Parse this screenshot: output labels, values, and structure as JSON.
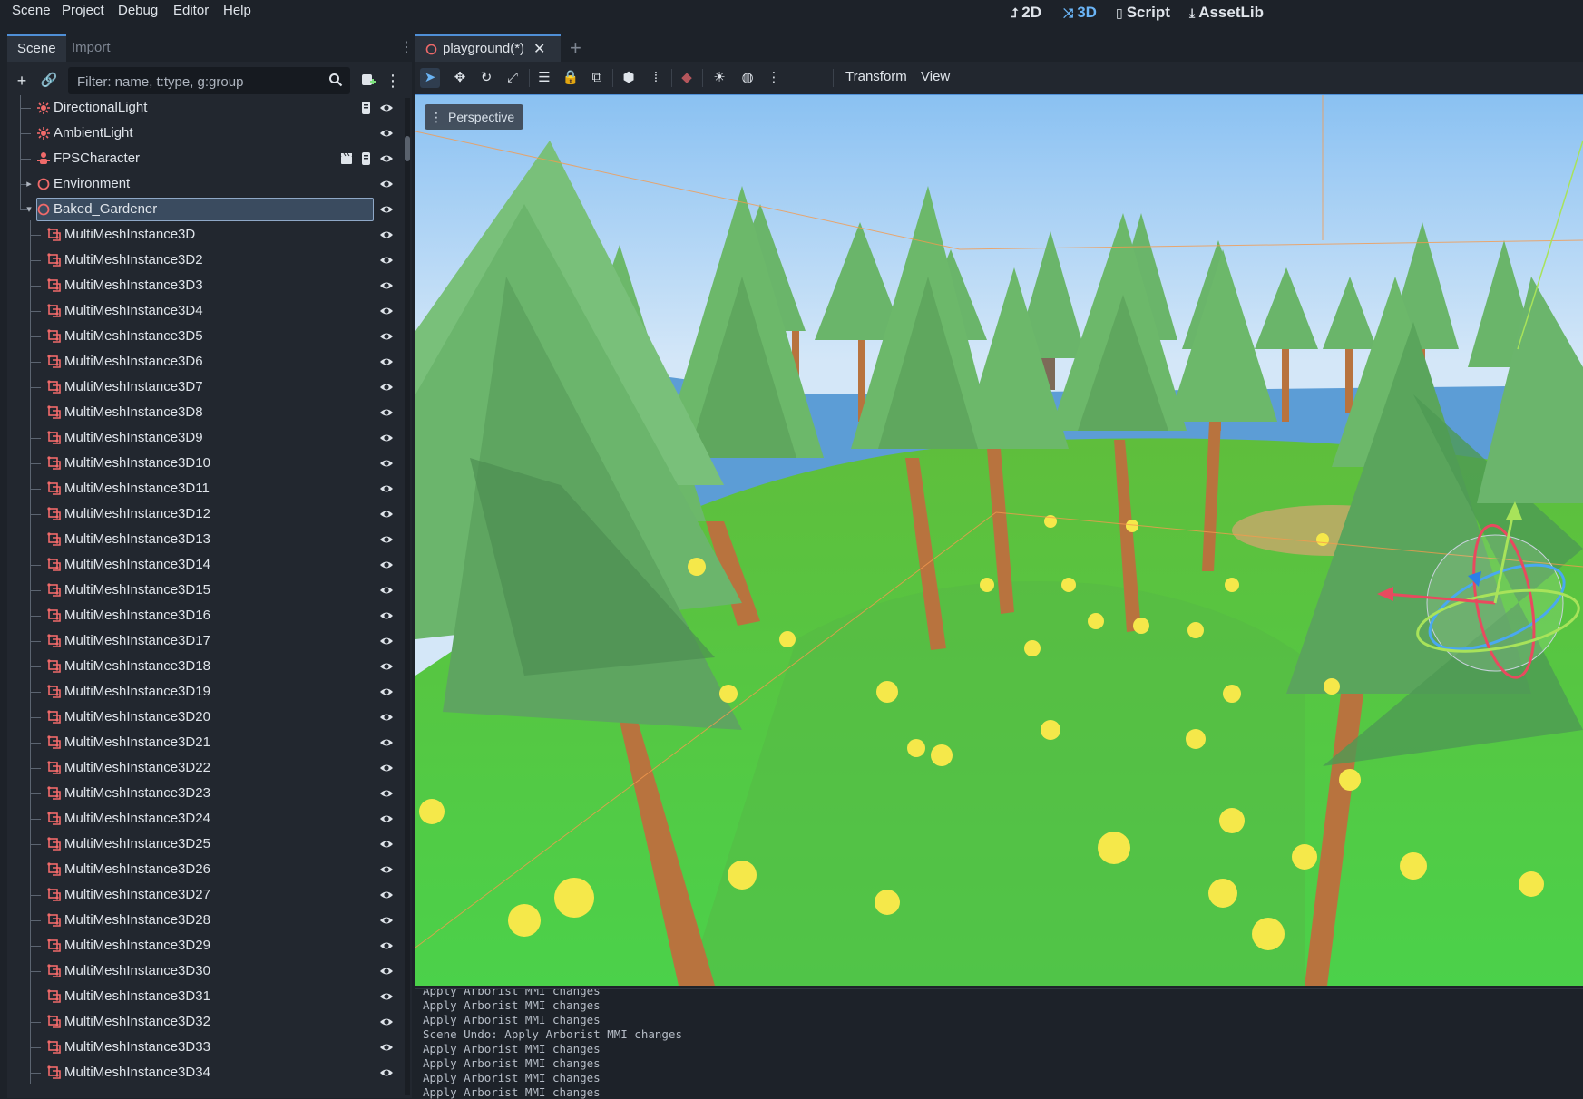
{
  "menubar": {
    "menus": [
      "Scene",
      "Project",
      "Debug",
      "Editor",
      "Help"
    ],
    "workspaces": [
      {
        "label": "2D",
        "icon": "2d-icon",
        "active": false
      },
      {
        "label": "3D",
        "icon": "3d-icon",
        "active": true
      },
      {
        "label": "Script",
        "icon": "script-icon",
        "active": false
      },
      {
        "label": "AssetLib",
        "icon": "assetlib-icon",
        "active": false
      }
    ]
  },
  "scene_dock": {
    "tabs": [
      "Scene",
      "Import"
    ],
    "active_tab": "Scene",
    "filter_placeholder": "Filter: name, t:type, g:group",
    "tree": {
      "top_nodes": [
        {
          "label": "DirectionalLight",
          "icon": "light-icon",
          "extra": [
            "script-icon"
          ]
        },
        {
          "label": "AmbientLight",
          "icon": "light-icon",
          "extra": []
        },
        {
          "label": "FPSCharacter",
          "icon": "character-icon",
          "extra": [
            "clapboard-icon",
            "script-icon"
          ]
        },
        {
          "label": "Environment",
          "icon": "node3d-icon",
          "extra": [],
          "collapsed": true
        },
        {
          "label": "Baked_Gardener",
          "icon": "node3d-icon",
          "extra": [],
          "selected": true,
          "expanded": true
        }
      ],
      "children": [
        "MultiMeshInstance3D",
        "MultiMeshInstance3D2",
        "MultiMeshInstance3D3",
        "MultiMeshInstance3D4",
        "MultiMeshInstance3D5",
        "MultiMeshInstance3D6",
        "MultiMeshInstance3D7",
        "MultiMeshInstance3D8",
        "MultiMeshInstance3D9",
        "MultiMeshInstance3D10",
        "MultiMeshInstance3D11",
        "MultiMeshInstance3D12",
        "MultiMeshInstance3D13",
        "MultiMeshInstance3D14",
        "MultiMeshInstance3D15",
        "MultiMeshInstance3D16",
        "MultiMeshInstance3D17",
        "MultiMeshInstance3D18",
        "MultiMeshInstance3D19",
        "MultiMeshInstance3D20",
        "MultiMeshInstance3D21",
        "MultiMeshInstance3D22",
        "MultiMeshInstance3D23",
        "MultiMeshInstance3D24",
        "MultiMeshInstance3D25",
        "MultiMeshInstance3D26",
        "MultiMeshInstance3D27",
        "MultiMeshInstance3D28",
        "MultiMeshInstance3D29",
        "MultiMeshInstance3D30",
        "MultiMeshInstance3D31",
        "MultiMeshInstance3D32",
        "MultiMeshInstance3D33",
        "MultiMeshInstance3D34"
      ]
    }
  },
  "editor": {
    "scene_tab": "playground(*)",
    "viewport_menus": [
      "Transform",
      "View"
    ],
    "viewport_mode": "Perspective"
  },
  "output": {
    "lines": [
      "Apply Arborist MMI changes",
      "Apply Arborist MMI changes",
      "Apply Arborist MMI changes",
      "Scene Undo: Apply Arborist MMI changes",
      "Apply Arborist MMI changes",
      "Apply Arborist MMI changes",
      "Apply Arborist MMI changes",
      "Apply Arborist MMI changes"
    ]
  },
  "colors": {
    "accent": "#4f8fd6",
    "node_icon": "#f06a6a",
    "sky_top": "#79b6ef",
    "grass": "#6fc94a",
    "tree_green": "#6fb96a",
    "trunk": "#b8733e"
  }
}
